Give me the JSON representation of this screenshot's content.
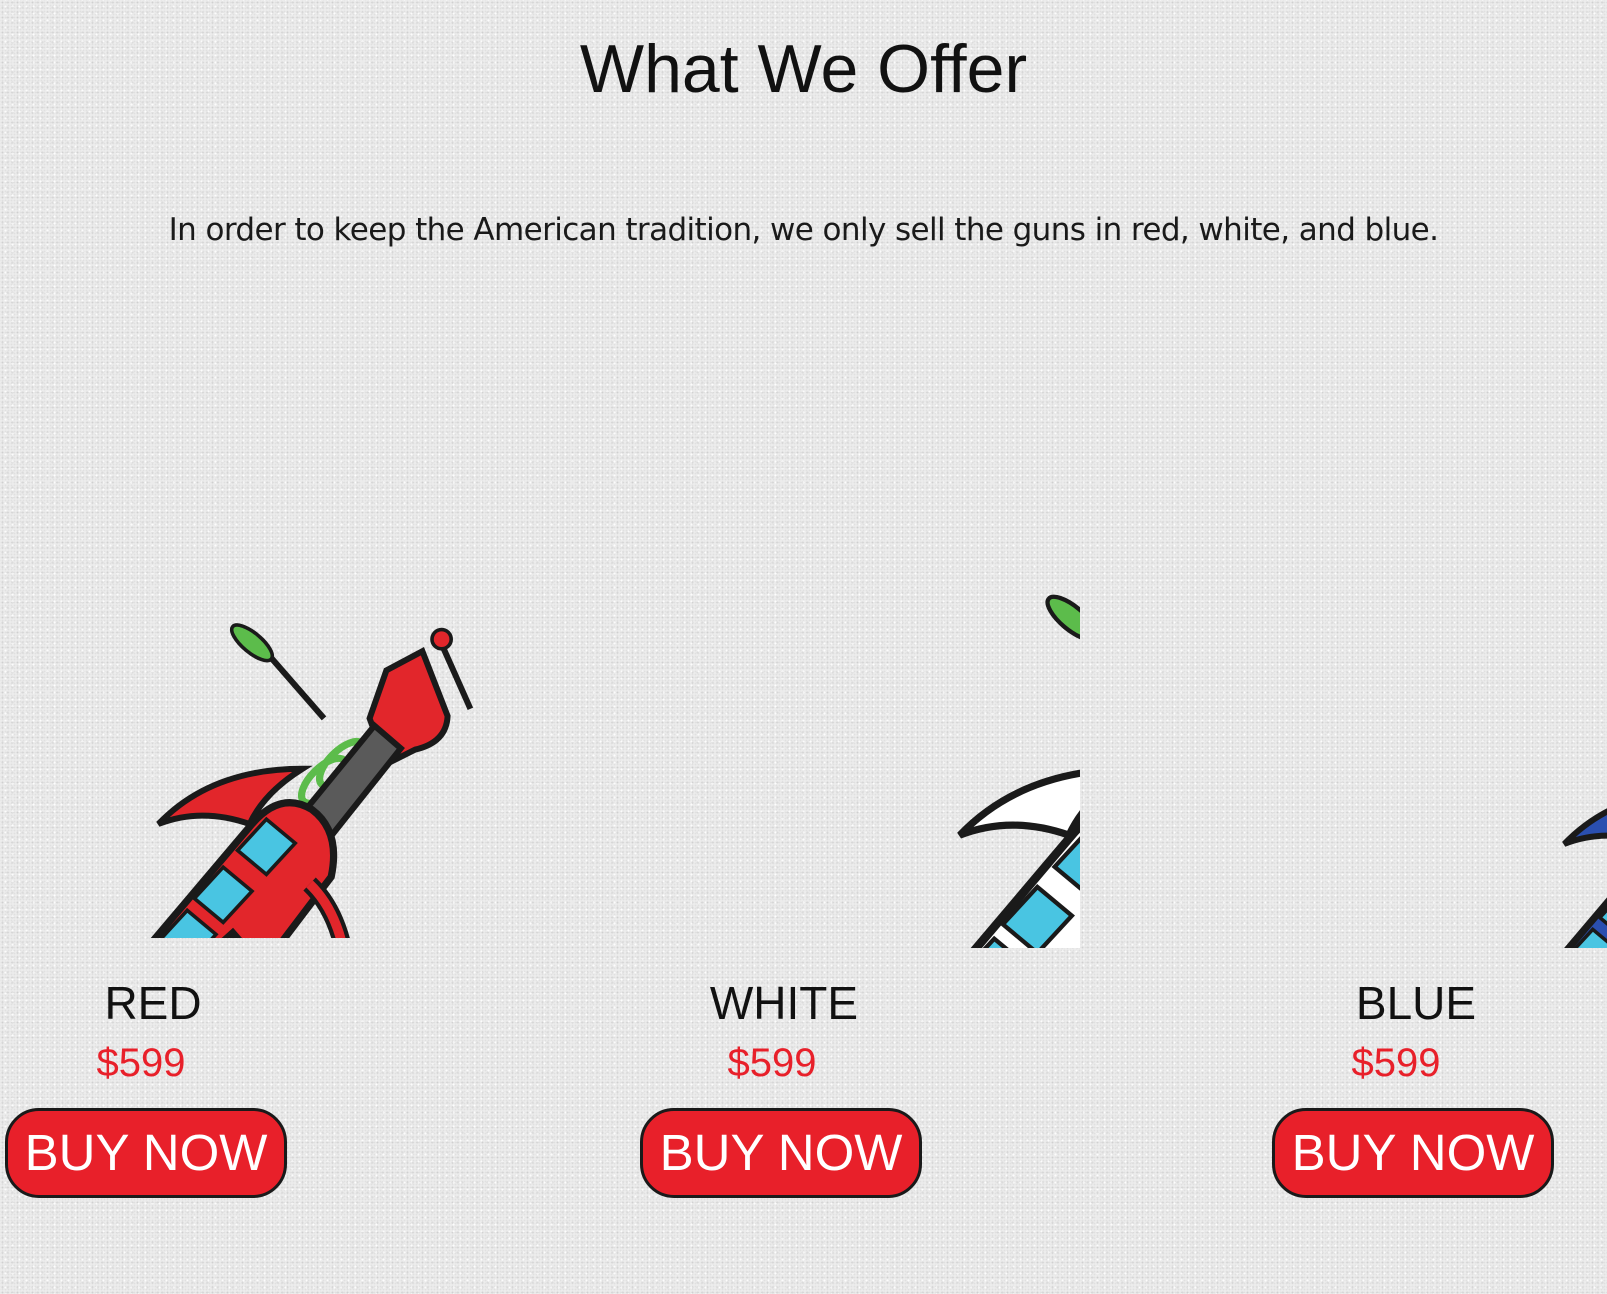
{
  "page": {
    "title": "What We Offer",
    "subtitle": "In order to keep the American tradition, we only sell the guns in red, white, and blue."
  },
  "products": [
    {
      "name": "RED",
      "price": "$599",
      "button_label": "BUY NOW",
      "image_icon": "ray-gun-red-icon",
      "body_color": "#e2262b"
    },
    {
      "name": "WHITE",
      "price": "$599",
      "button_label": "BUY NOW",
      "image_icon": "ray-gun-white-icon",
      "body_color": "#ffffff"
    },
    {
      "name": "BLUE",
      "price": "$599",
      "button_label": "BUY NOW",
      "image_icon": "ray-gun-blue-icon",
      "body_color": "#2a4fb0"
    }
  ],
  "colors": {
    "accent_red": "#e8202a",
    "price_red": "#e8202a",
    "tube_cyan": "#49c5e2",
    "grip_gray": "#5a5a5a",
    "meter_green": "#5cbc4b",
    "meter_yellow": "#f2e530"
  }
}
